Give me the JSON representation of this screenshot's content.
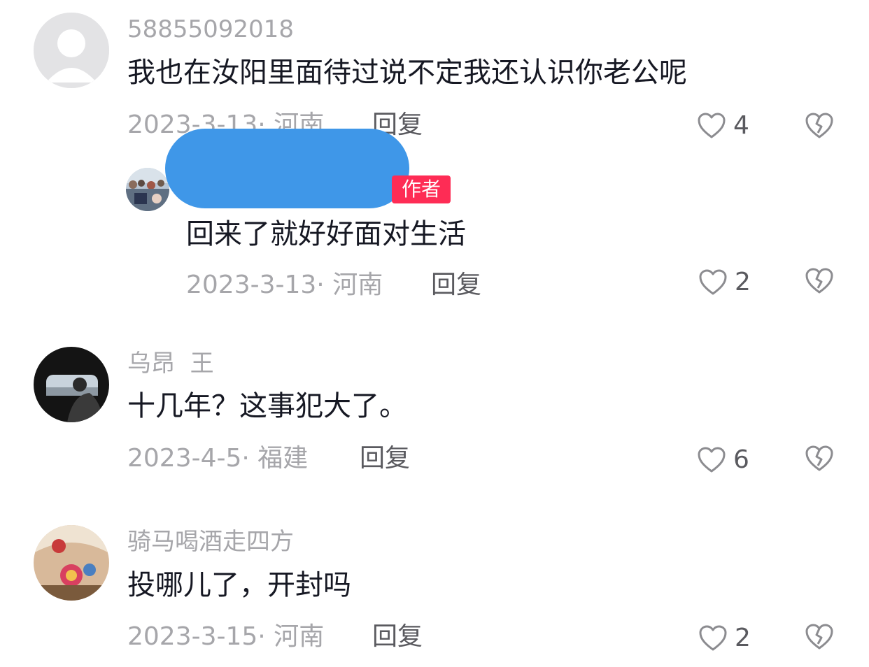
{
  "comments": [
    {
      "username": "58855092018",
      "text": "我也在汝阳里面待过说不定我还认识你老公呢",
      "meta": "2023-3-13· 河南",
      "reply_label": "回复",
      "likes": "4"
    },
    {
      "username": "",
      "badge": "作者",
      "text": "回来了就好好面对生活",
      "meta": "2023-3-13· 河南",
      "reply_label": "回复",
      "likes": "2"
    },
    {
      "username": "乌昂  王",
      "text": "十几年？这事犯大了。",
      "meta": "2023-4-5· 福建",
      "reply_label": "回复",
      "likes": "6"
    },
    {
      "username": "骑马喝酒走四方",
      "text": "投哪儿了，开封吗",
      "meta": "2023-3-15· 河南",
      "reply_label": "回复",
      "likes": "2"
    }
  ],
  "colors": {
    "username": "#a6a6aa",
    "text": "#161823",
    "reply": "#5a5a5f",
    "badge": "#fe2c55",
    "redaction": "#3f97e8"
  },
  "icons": [
    "heart-outline-icon",
    "broken-heart-icon",
    "default-avatar-icon"
  ]
}
